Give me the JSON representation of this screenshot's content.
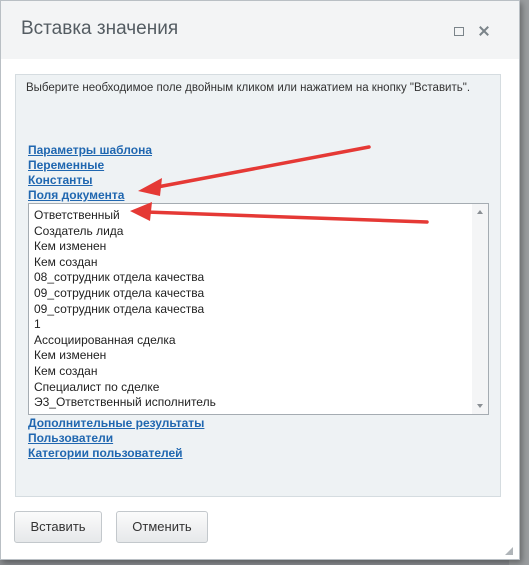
{
  "dialog": {
    "title": "Вставка значения",
    "instruction": "Выберите необходимое поле двойным кликом или нажатием на кнопку \"Вставить\"."
  },
  "links_top": [
    "Параметры шаблона",
    "Переменные",
    "Константы",
    "Поля документа"
  ],
  "document_fields": [
    "Ответственный",
    "Создатель лида",
    "Кем изменен",
    "Кем создан",
    "08_сотрудник отдела качества",
    "09_сотрудник отдела качества",
    "09_сотрудник отдела качества",
    "1",
    "Ассоциированная сделка",
    "Кем изменен",
    "Кем создан",
    "Специалист по сделке",
    "Э3_Ответственный исполнитель"
  ],
  "links_bottom": [
    "Дополнительные результаты",
    "Пользователи",
    "Категории пользователей"
  ],
  "buttons": {
    "insert": "Вставить",
    "cancel": "Отменить"
  },
  "colors": {
    "link": "#2067b0",
    "annotation_arrow": "#e53935"
  },
  "icons": [
    "maximize-icon",
    "close-icon",
    "scroll-up-icon",
    "scroll-down-icon",
    "resize-grip-icon"
  ]
}
